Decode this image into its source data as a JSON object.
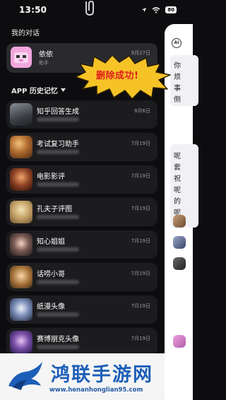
{
  "status_bar": {
    "time": "13:50",
    "battery": "80"
  },
  "sections": {
    "my_chats": "我的对话",
    "app_history": "APP 历史记忆"
  },
  "current_chat": {
    "name": "依依",
    "subtitle": "助手",
    "date": "9月27日"
  },
  "toast": {
    "text": "删除成功!"
  },
  "history": [
    {
      "title": "知乎回答生成",
      "date": "8月6日"
    },
    {
      "title": "考试复习助手",
      "date": "7月19日"
    },
    {
      "title": "电影影评",
      "date": "7月19日"
    },
    {
      "title": "孔夫子评图",
      "date": "7月19日"
    },
    {
      "title": "知心姐姐",
      "date": "7月19日"
    },
    {
      "title": "话唠小哥",
      "date": "7月19日"
    },
    {
      "title": "纸漫头像",
      "date": "7月19日"
    },
    {
      "title": "赛博朋克头像",
      "date": "7月19日"
    }
  ],
  "right_panel": {
    "ai_icon": "AI",
    "lines_top": [
      "你",
      "烦",
      "事",
      "侧"
    ],
    "lines_mid": [
      "呢",
      "套",
      "祝",
      "呢",
      "的",
      "呢"
    ]
  },
  "watermark": {
    "title": "鸿联手游网",
    "url": "www.henanhonglian95.com"
  },
  "colors": {
    "background": "#0d0d0f",
    "card": "#1c1c1f",
    "highlight": "#2a2a2e",
    "toast_fill": "#f5c326",
    "toast_text": "#e11d1d",
    "watermark_blue": "#1d5fb8"
  }
}
